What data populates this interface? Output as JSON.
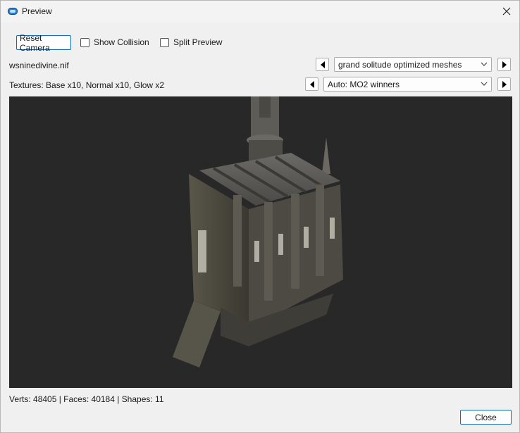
{
  "window": {
    "title": "Preview"
  },
  "toolbar": {
    "reset_camera": "Reset Camera",
    "show_collision": "Show Collision",
    "split_preview": "Split Preview"
  },
  "file": {
    "name": "wsninedivine.nif",
    "mesh_source": "grand solitude optimized meshes"
  },
  "textures": {
    "summary": "Textures: Base x10, Normal x10, Glow x2",
    "source": "Auto: MO2 winners"
  },
  "stats": "Verts: 48405 | Faces: 40184 | Shapes: 11",
  "footer": {
    "close": "Close"
  },
  "colors": {
    "viewport_bg": "#282828",
    "accent": "#0f6cbd",
    "window_bg": "#f0f0f0"
  },
  "icons": [
    "app-icon",
    "close-icon",
    "left-arrow-icon",
    "right-arrow-icon",
    "chevron-down-icon"
  ]
}
